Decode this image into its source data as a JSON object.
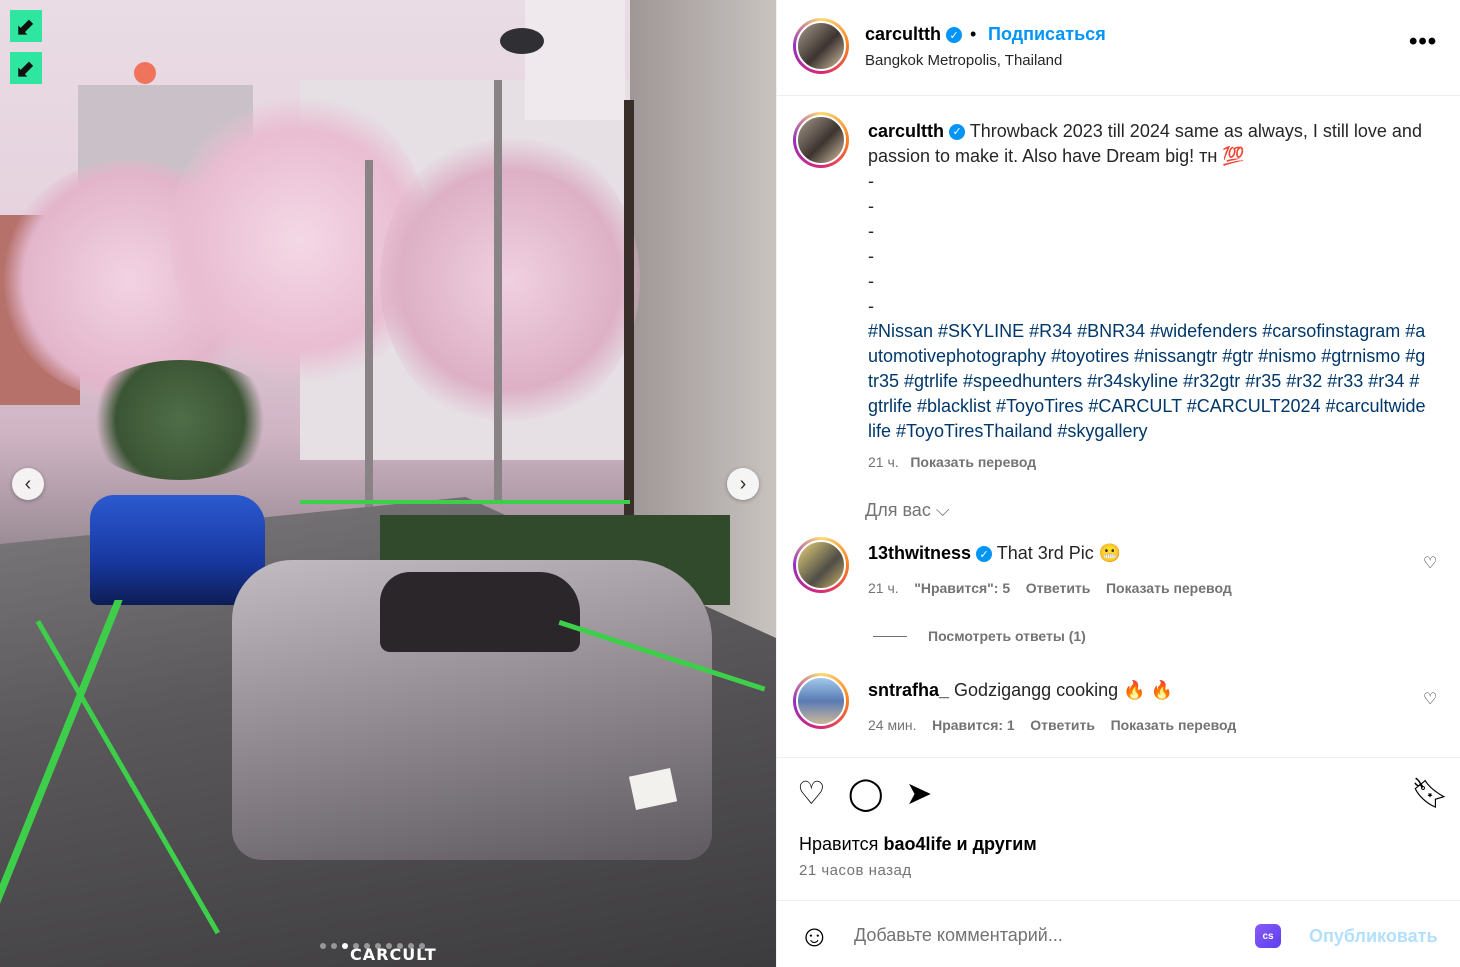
{
  "post": {
    "username": "carcultth",
    "follow_label": "Подписаться",
    "location": "Bangkok Metropolis, Thailand",
    "more_label": "•••",
    "caption": {
      "username": "carcultth",
      "text": "Throwback 2023 till 2024 same as always, I still love and passion to make it. Also have Dream big! ᴛʜ 💯",
      "dashes": [
        "-",
        "-",
        "-",
        "-",
        "-",
        "-"
      ],
      "hashtags": "#Nissan #SKYLINE #R34 #BNR34  #widefenders  #carsofinstagram #automotivephotography #toyotires #nissangtr #gtr #nismo #gtrnismo #gtr35 #gtrlife #speedhunters #r34skyline #r32gtr #r35  #r32 #r33 #r34 #gtrlife #blacklist  #ToyoTires #CARCULT #CARCULT2024 #carcultwidelife #ToyoTiresThailand #skygallery",
      "time": "21 ч.",
      "translate": "Показать перевод"
    },
    "for_you": "Для вас ⌵",
    "comments": [
      {
        "username": "13thwitness",
        "text": "That 3rd Pic 😬",
        "time": "21 ч.",
        "likes": "\"Нравится\": 5",
        "reply": "Ответить",
        "translate": "Показать перевод",
        "view_replies": "Посмотреть ответы (1)"
      },
      {
        "username": "sntrafha_",
        "text": "Godzigangg cooking 🔥 🔥",
        "time": "24 мин.",
        "likes": "Нравится: 1",
        "reply": "Ответить",
        "translate": "Показать перевод"
      }
    ],
    "likes_prefix": "Нравится",
    "likes_user": "bao4life",
    "likes_suffix": "и другим",
    "posted_ago": "21 часов назад",
    "comment_placeholder": "Добавьте комментарий...",
    "cs_badge": "cs",
    "publish_label": "Опубликовать"
  },
  "photo": {
    "watermark": "CARCULT",
    "corner_icons": [
      "⬋",
      "⬋"
    ],
    "prev_icon": "‹",
    "next_icon": "›",
    "carousel_count": 10,
    "carousel_active": 2
  },
  "colors": {
    "accent": "#0095f6",
    "hashtag": "#00376b",
    "muted": "#737373",
    "publish_disabled": "#b2dffc"
  }
}
